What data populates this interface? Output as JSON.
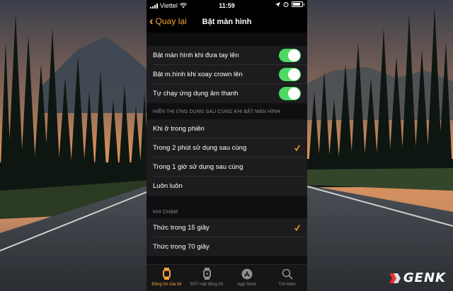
{
  "status_bar": {
    "carrier": "Viettel",
    "time": "11:59"
  },
  "nav": {
    "back_label": "Quay lại",
    "title": "Bật màn hình"
  },
  "toggles": [
    {
      "label": "Bật màn hình khi đưa tay lên",
      "on": true
    },
    {
      "label": "Bật m.hình khi xoay crown lên",
      "on": true
    },
    {
      "label": "Tự chạy ứng dụng âm thanh",
      "on": true
    }
  ],
  "section_show_app": {
    "header": "HIỂN THỊ ỨNG DỤNG SAU CÙNG KHI BẬT MÀN HÌNH",
    "options": [
      {
        "label": "Khi ở trong phiên",
        "selected": false
      },
      {
        "label": "Trong 2 phút sử dụng sau cùng",
        "selected": true
      },
      {
        "label": "Trong 1 giờ sử dụng sau cùng",
        "selected": false
      },
      {
        "label": "Luôn luôn",
        "selected": false
      }
    ]
  },
  "section_on_tap": {
    "header": "KHI CHẠM",
    "options": [
      {
        "label": "Thức trong 15 giây",
        "selected": true
      },
      {
        "label": "Thức trong 70 giây",
        "selected": false
      }
    ]
  },
  "tab_bar": [
    {
      "label": "Đồng hồ của tôi",
      "icon": "watch-icon",
      "active": true
    },
    {
      "label": "BST mặt đồng hồ",
      "icon": "watch-face-icon",
      "active": false
    },
    {
      "label": "App Store",
      "icon": "app-store-icon",
      "active": false
    },
    {
      "label": "Tìm kiếm",
      "icon": "search-icon",
      "active": false
    }
  ],
  "watermark": {
    "brand": "GENK"
  },
  "colors": {
    "accent": "#f7a33b",
    "toggle_on": "#4cd964",
    "cell_bg": "#1c1c1e",
    "header_text": "#8e8e93"
  }
}
